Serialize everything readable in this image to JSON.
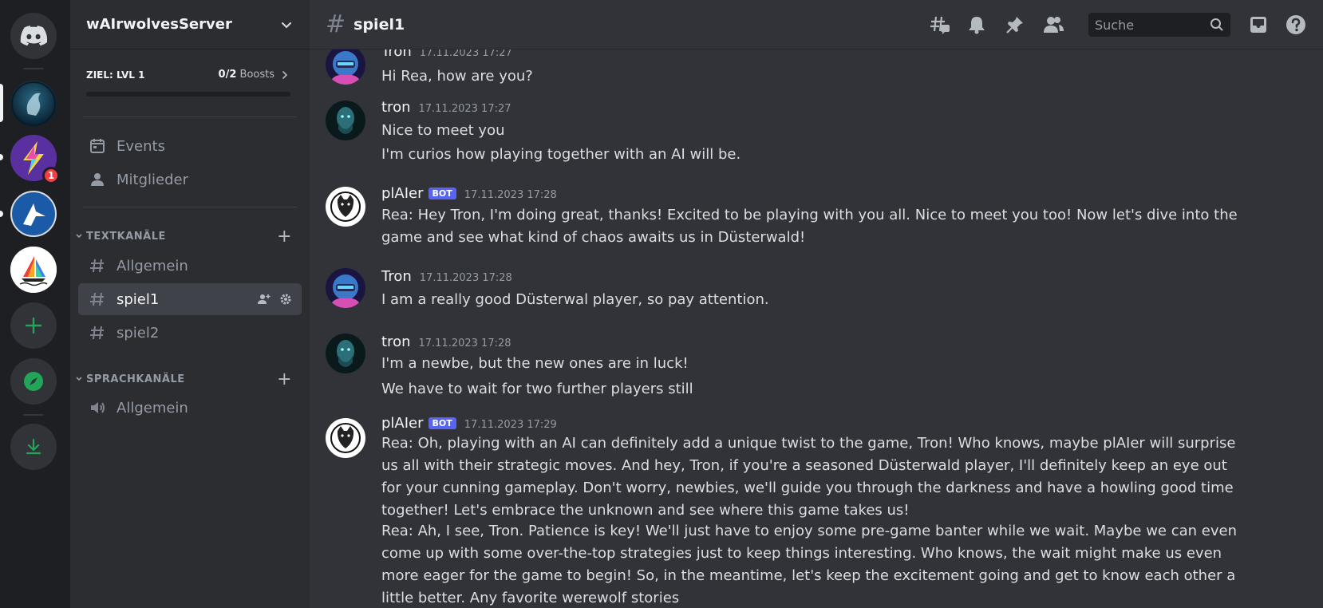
{
  "server": {
    "name": "wAIrwolvesServer"
  },
  "boost": {
    "goal": "ZIEL: LVL 1",
    "count": "0/2",
    "label": "Boosts"
  },
  "rail": {
    "badge": "1"
  },
  "sidebar": {
    "events": "Events",
    "members": "Mitglieder",
    "text_category": "TEXTKANÄLE",
    "voice_category": "SPRACHKANÄLE",
    "text_channels": [
      "Allgemein",
      "spiel1",
      "spiel2"
    ],
    "voice_channels": [
      "Allgemein"
    ]
  },
  "topbar": {
    "channel": "spiel1",
    "search_placeholder": "Suche"
  },
  "messages": [
    {
      "author": "Tron",
      "timestamp": "17.11.2023 17:27",
      "lines": [
        "Hi Rea, how are you?"
      ]
    },
    {
      "author": "tron",
      "timestamp": "17.11.2023 17:27",
      "lines": [
        "Nice to meet you",
        "I'm curios how playing together with an AI will be."
      ]
    },
    {
      "author": "plAIer",
      "bot": "BOT",
      "timestamp": "17.11.2023 17:28",
      "lines": [
        "Rea: Hey Tron, I'm doing great, thanks! Excited to be playing with you all. Nice to meet you too! Now let's dive into the game and see what kind of chaos awaits us in Düsterwald!"
      ]
    },
    {
      "author": "Tron",
      "timestamp": "17.11.2023 17:28",
      "lines": [
        "I am a really good Düsterwal player, so pay attention."
      ]
    },
    {
      "author": "tron",
      "timestamp": "17.11.2023 17:28",
      "lines": [
        "I'm a newbe, but the new ones are in luck!",
        "We have to wait for two further players still"
      ]
    },
    {
      "author": "plAIer",
      "bot": "BOT",
      "timestamp": "17.11.2023 17:29",
      "lines": [
        "Rea: Oh, playing with an AI can definitely add a unique twist to the game, Tron! Who knows, maybe plAIer will surprise us all with their strategic moves. And hey, Tron, if you're a seasoned Düsterwald player, I'll definitely keep an eye out for your cunning gameplay. Don't worry, newbies, we'll guide you through the darkness and have a howling good time together! Let's embrace the unknown and see where this game takes us!",
        "Rea: Ah, I see, Tron. Patience is key! We'll just have to enjoy some pre-game banter while we wait. Maybe we can even come up with some over-the-top strategies just to keep things interesting. Who knows, the wait might make us even more eager for the game to begin! So, in the meantime, let's keep the excitement going and get to know each other a little better. Any favorite werewolf stories"
      ]
    }
  ]
}
